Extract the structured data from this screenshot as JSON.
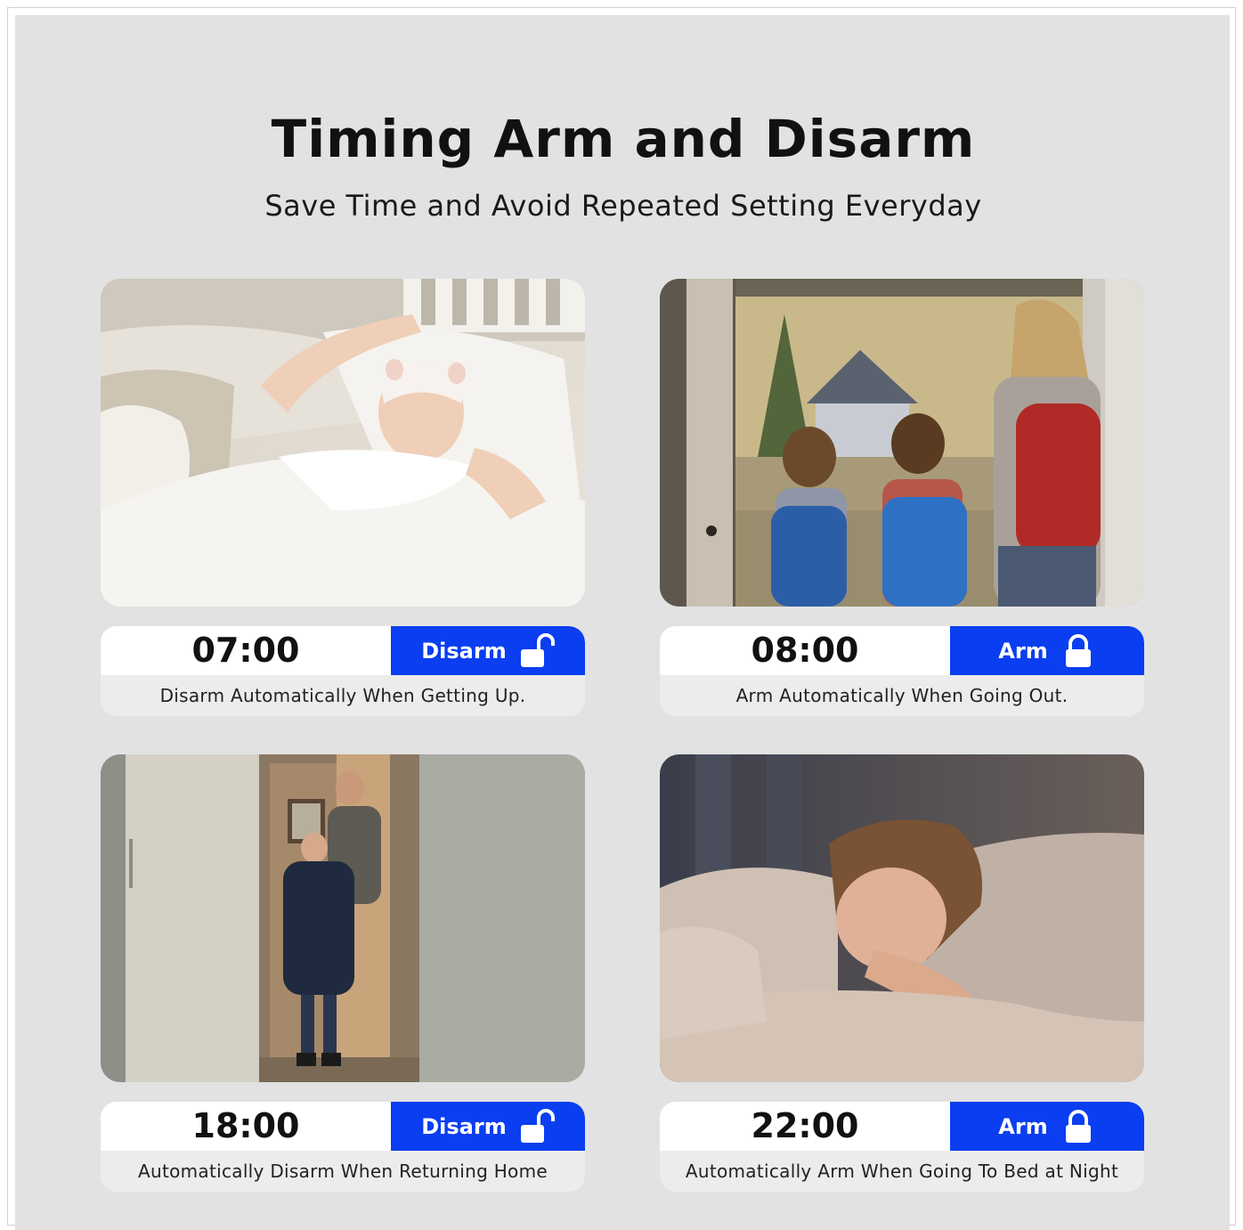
{
  "header": {
    "title": "Timing Arm and Disarm",
    "subtitle": "Save Time and Avoid Repeated Setting Everyday"
  },
  "colors": {
    "accent": "#0a3ef0",
    "background": "#e2e2e2"
  },
  "cards": [
    {
      "time": "07:00",
      "mode": "Disarm",
      "icon": "unlocked-padlock-icon",
      "caption": "Disarm Automatically When Getting Up."
    },
    {
      "time": "08:00",
      "mode": "Arm",
      "icon": "locked-padlock-icon",
      "caption": "Arm Automatically When Going Out."
    },
    {
      "time": "18:00",
      "mode": "Disarm",
      "icon": "unlocked-padlock-icon",
      "caption": "Automatically Disarm When Returning Home"
    },
    {
      "time": "22:00",
      "mode": "Arm",
      "icon": "locked-padlock-icon",
      "caption": "Automatically Arm When Going To Bed at Night"
    }
  ]
}
